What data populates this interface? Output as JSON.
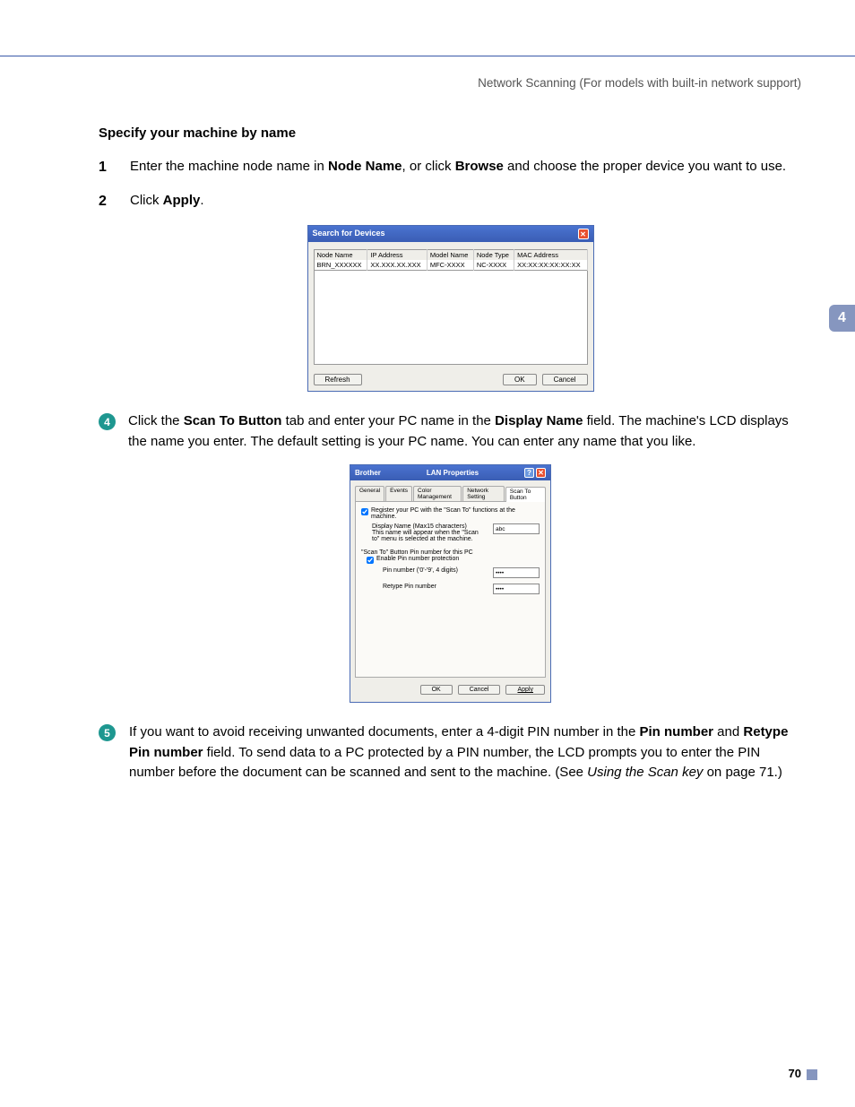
{
  "header": "Network Scanning (For models with built-in network support)",
  "side_tab": "4",
  "section_title": "Specify your machine by name",
  "step1": {
    "num": "1",
    "text_before": "Enter the machine node name in ",
    "bold1": "Node Name",
    "text_mid": ", or click ",
    "bold2": "Browse",
    "text_after": " and choose the proper device you want to use."
  },
  "step2": {
    "num": "2",
    "text": "Click ",
    "bold": "Apply",
    "dot": "."
  },
  "dialog1": {
    "title": "Search for Devices",
    "cols": [
      "Node Name",
      "IP Address",
      "Model Name",
      "Node Type",
      "MAC Address"
    ],
    "row": [
      "BRN_XXXXXX",
      "XX.XXX.XX.XXX",
      "MFC-XXXX",
      "NC-XXXX",
      "XX:XX:XX:XX:XX:XX"
    ],
    "refresh": "Refresh",
    "ok": "OK",
    "cancel": "Cancel"
  },
  "step4": {
    "num": "4",
    "t1": "Click the ",
    "b1": "Scan To Button",
    "t2": " tab and enter your PC name in the ",
    "b2": "Display Name",
    "t3": " field. The machine's LCD displays the name you enter. The default setting is your PC name. You can enter any name that you like."
  },
  "dialog2": {
    "brand": "Brother",
    "title": "LAN Properties",
    "tabs": [
      "General",
      "Events",
      "Color Management",
      "Network Setting",
      "Scan To Button"
    ],
    "register": "Register your PC with the \"Scan To\" functions at the machine.",
    "display_block": "Display Name (Max15 characters)\nThis name will appear when the \"Scan to\" menu is selected at the machine.",
    "display_value": "abc",
    "pin_section": "\"Scan To\" Button Pin number for this PC",
    "enable_pin": "Enable Pin number protection",
    "pin_label": "Pin number ('0'-'9', 4 digits)",
    "retype_label": "Retype Pin number",
    "pin_value": "••••",
    "ok": "OK",
    "cancel": "Cancel",
    "apply": "Apply"
  },
  "step5": {
    "num": "5",
    "t1": "If you want to avoid receiving unwanted documents, enter a 4-digit PIN number in the ",
    "b1": "Pin number",
    "t2": " and ",
    "b2": "Retype Pin number",
    "t3": " field. To send data to a PC protected by a PIN number, the LCD prompts you to enter the PIN number before the document can be scanned and sent to the machine. (See ",
    "i1": "Using the Scan key",
    "t4": " on page 71.)"
  },
  "page_number": "70"
}
